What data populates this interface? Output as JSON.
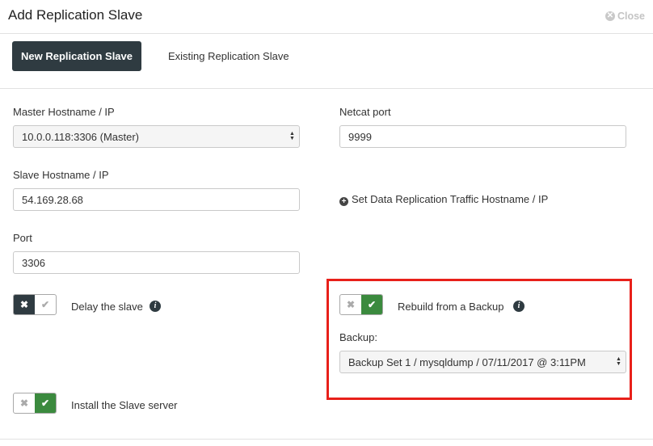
{
  "dialog": {
    "title": "Add Replication Slave",
    "close_label": "Close"
  },
  "tabs": [
    {
      "label": "New Replication Slave",
      "active": true
    },
    {
      "label": "Existing Replication Slave",
      "active": false
    }
  ],
  "form": {
    "master_hostname": {
      "label": "Master Hostname / IP",
      "value": "10.0.0.118:3306 (Master)"
    },
    "netcat_port": {
      "label": "Netcat port",
      "value": "9999"
    },
    "slave_hostname": {
      "label": "Slave Hostname / IP",
      "value": "54.169.28.68"
    },
    "set_traffic_link": "Set Data Replication Traffic Hostname / IP",
    "port": {
      "label": "Port",
      "value": "3306"
    },
    "delay_slave": {
      "label": "Delay the slave",
      "enabled": false
    },
    "rebuild_backup": {
      "label": "Rebuild from a Backup",
      "enabled": true
    },
    "backup": {
      "label": "Backup:",
      "value": "Backup Set 1 / mysqldump / 07/11/2017 @ 3:11PM"
    },
    "install_slave": {
      "label": "Install the Slave server",
      "enabled": true
    }
  },
  "colors": {
    "accent_dark": "#2f3b41",
    "toggle_on": "#3b8a3e",
    "highlight": "#e8201a"
  },
  "icons": {
    "close": "close-circle-icon",
    "info": "info-icon",
    "plus": "plus-circle-icon",
    "check": "check-icon",
    "times": "times-icon"
  }
}
